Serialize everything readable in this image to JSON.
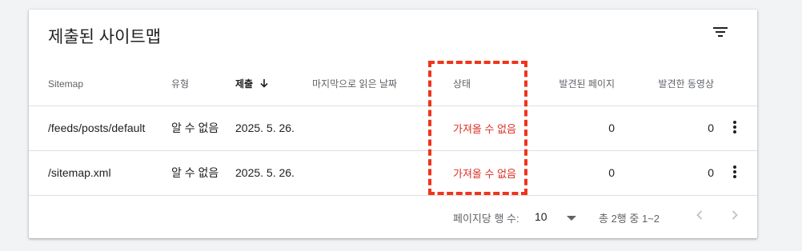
{
  "card": {
    "title": "제출된 사이트맵"
  },
  "table": {
    "headers": {
      "sitemap": "Sitemap",
      "type": "유형",
      "submitted": "제출",
      "last_read": "마지막으로 읽은 날짜",
      "status": "상태",
      "pages": "발견된 페이지",
      "videos": "발견한 동영상"
    },
    "rows": [
      {
        "sitemap": "/feeds/posts/default",
        "type": "알 수 없음",
        "submitted": "2025. 5. 26.",
        "last_read": "",
        "status": "가져올 수 없음",
        "pages": "0",
        "videos": "0"
      },
      {
        "sitemap": "/sitemap.xml",
        "type": "알 수 없음",
        "submitted": "2025. 5. 26.",
        "last_read": "",
        "status": "가져올 수 없음",
        "pages": "0",
        "videos": "0"
      }
    ]
  },
  "footer": {
    "rows_per_page_label": "페이지당 행 수:",
    "rows_per_page_value": "10",
    "range": "총 2행 중 1~2"
  },
  "colors": {
    "error": "#d93025",
    "highlight": "#f0341b",
    "icon": "#5f6368"
  },
  "icons": [
    "filter-icon",
    "sort-down-arrow-icon",
    "more-vert-icon",
    "dropdown-arrow-icon",
    "chevron-left-icon",
    "chevron-right-icon"
  ]
}
